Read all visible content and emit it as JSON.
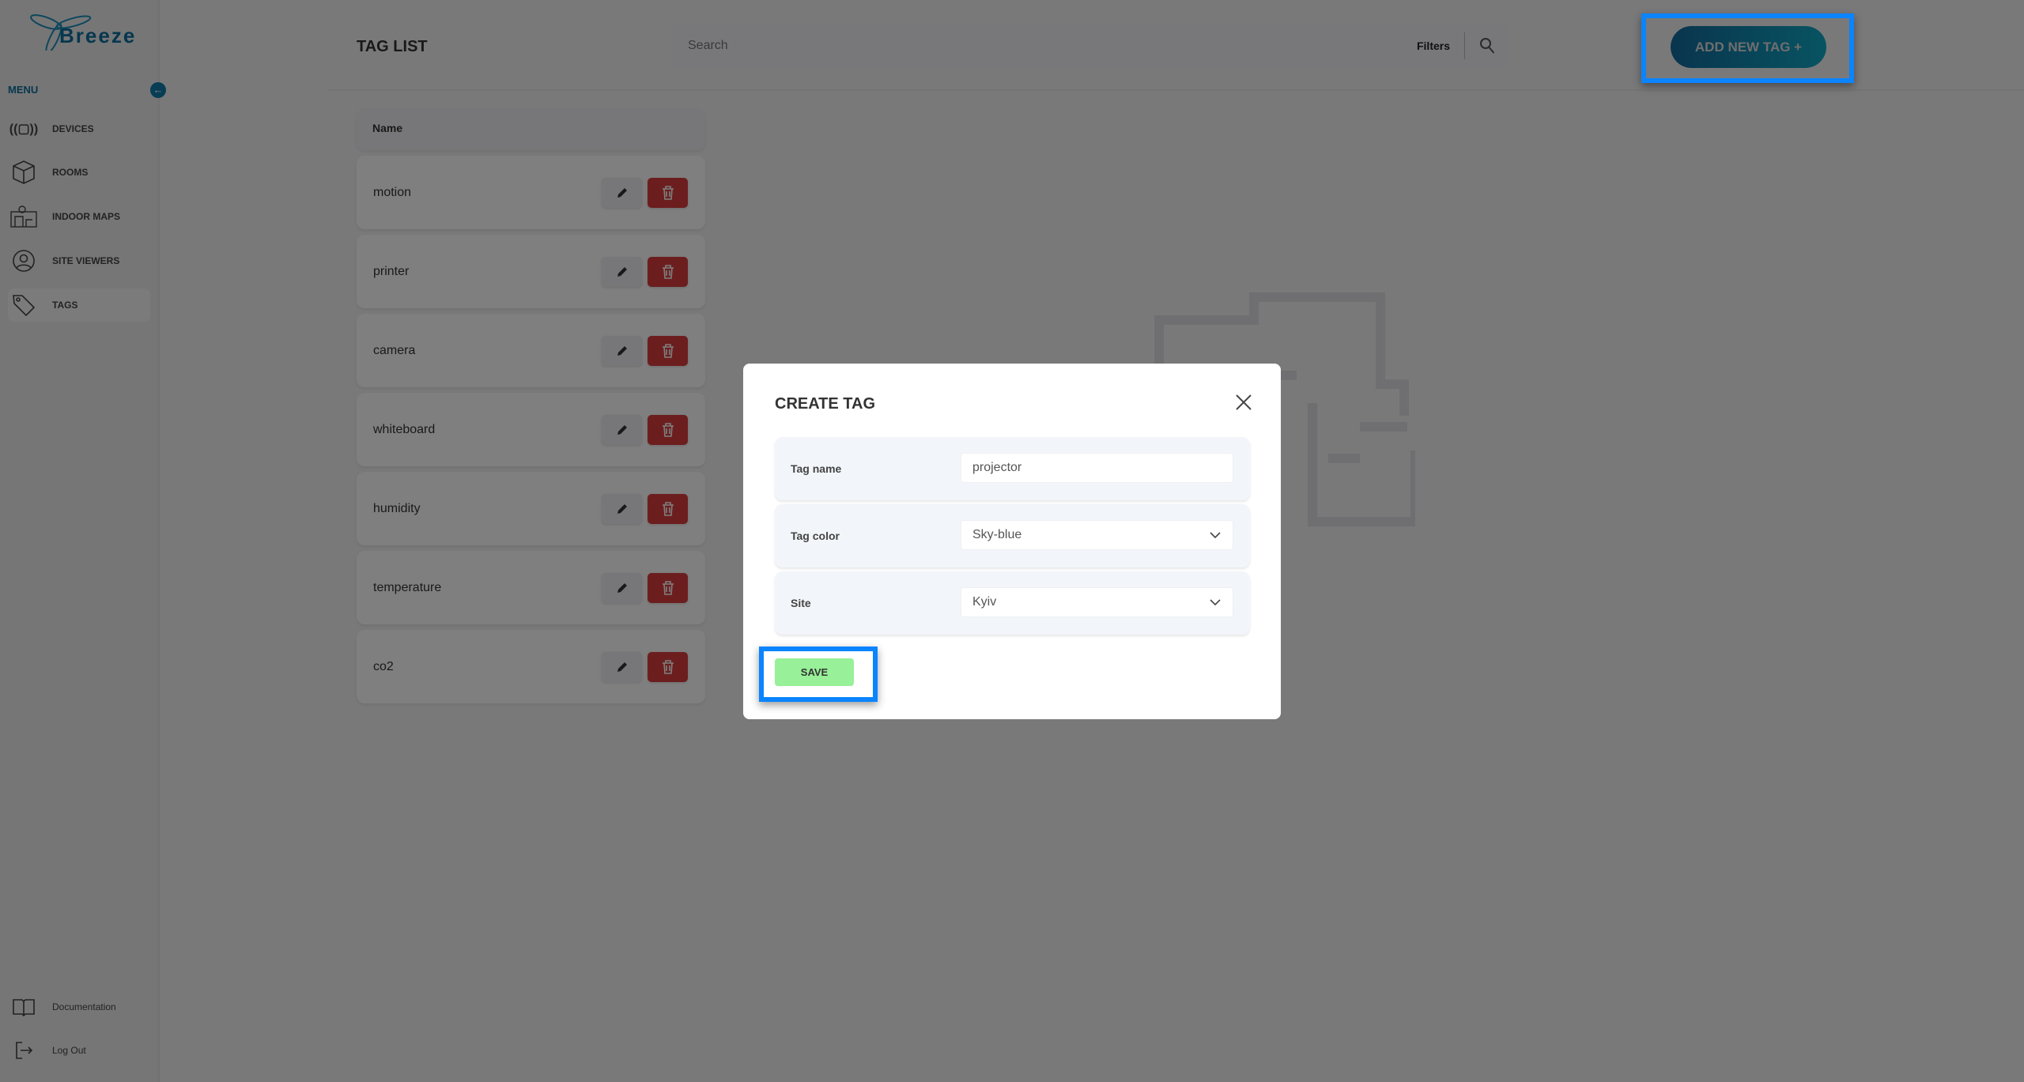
{
  "brand": {
    "name": "Breeze",
    "accent": "#0e6f9a"
  },
  "sidebar": {
    "menu_label": "MENU",
    "items": [
      {
        "label": "DEVICES",
        "icon": "devices-icon"
      },
      {
        "label": "ROOMS",
        "icon": "cube-icon"
      },
      {
        "label": "INDOOR MAPS",
        "icon": "map-icon"
      },
      {
        "label": "SITE VIEWERS",
        "icon": "user-circle-icon"
      },
      {
        "label": "TAGS",
        "icon": "tag-icon",
        "active": true
      }
    ],
    "bottom": [
      {
        "label": "Documentation",
        "icon": "book-icon"
      },
      {
        "label": "Log Out",
        "icon": "logout-icon"
      }
    ]
  },
  "header": {
    "title": "TAG LIST",
    "search_placeholder": "Search",
    "filters_label": "Filters",
    "add_button": "ADD NEW TAG +"
  },
  "table": {
    "column": "Name",
    "rows": [
      "motion",
      "printer",
      "camera",
      "whiteboard",
      "humidity",
      "temperature",
      "co2"
    ]
  },
  "modal": {
    "title": "CREATE TAG",
    "fields": [
      {
        "label": "Tag name",
        "value": "projector"
      },
      {
        "label": "Tag color",
        "value": "Sky-blue"
      },
      {
        "label": "Site",
        "value": "Kyiv"
      }
    ],
    "save_label": "SAVE"
  },
  "colors": {
    "highlight": "#0a84ff",
    "save": "#98f098",
    "delete": "#d83c3c"
  }
}
